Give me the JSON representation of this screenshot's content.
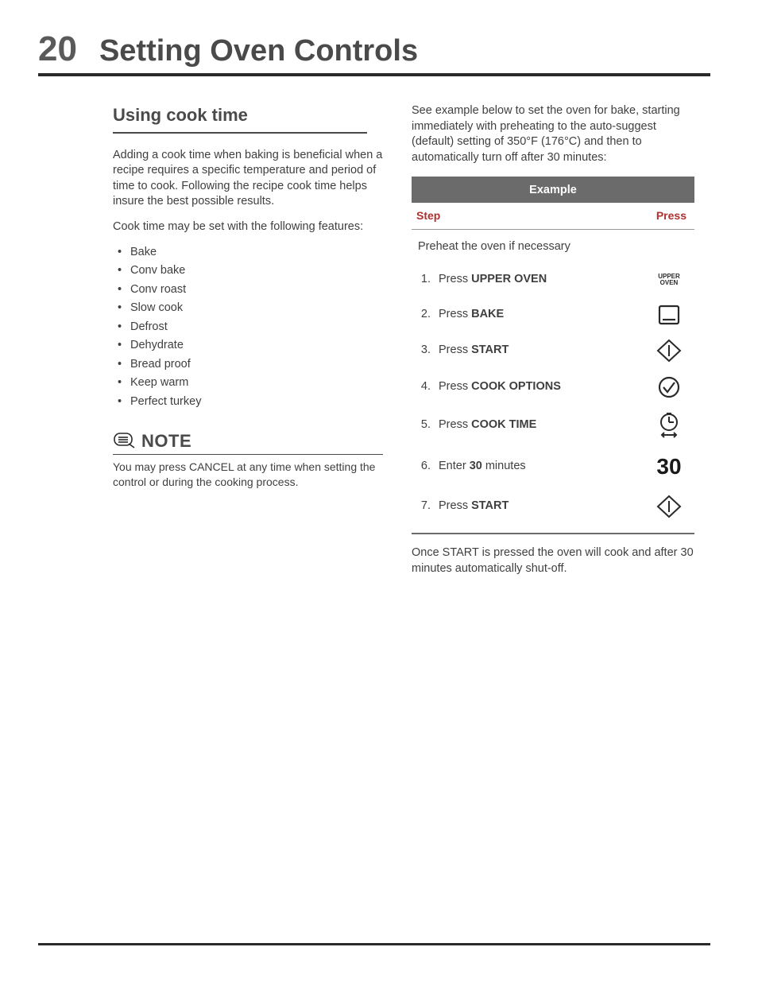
{
  "page_number": "20",
  "page_title": "Setting Oven Controls",
  "section_heading": "Using cook time",
  "intro_para": "Adding a cook time when baking is beneficial when a recipe requires a specific temperature and period of time to cook. Following the recipe cook time helps insure the best possible results.",
  "features_lead": "Cook time may be set with the following features:",
  "features": [
    "Bake",
    "Conv bake",
    "Conv roast",
    "Slow cook",
    "Defrost",
    "Dehydrate",
    "Bread proof",
    "Keep warm",
    "Perfect turkey"
  ],
  "note": {
    "label": "NOTE",
    "text": "You may press CANCEL at any time when setting the control or during the cooking process."
  },
  "right_intro": "See example below to set the oven for bake, starting immediately with preheating to the auto-suggest (default) setting of 350°F (176°C) and then to automatically turn off after 30 minutes:",
  "table": {
    "banner": "Example",
    "col_step": "Step",
    "col_press": "Press",
    "preheat_row": "Preheat the oven if necessary",
    "steps": [
      {
        "n": "1.",
        "pre": "Press ",
        "bold": "UPPER OVEN",
        "post": "",
        "icon": "upper-oven"
      },
      {
        "n": "2.",
        "pre": "Press ",
        "bold": "BAKE",
        "post": "",
        "icon": "bake"
      },
      {
        "n": "3.",
        "pre": "Press ",
        "bold": "START",
        "post": "",
        "icon": "start"
      },
      {
        "n": "4.",
        "pre": "Press ",
        "bold": "COOK OPTIONS",
        "post": "",
        "icon": "options"
      },
      {
        "n": "5.",
        "pre": "Press ",
        "bold": "COOK TIME",
        "post": "",
        "icon": "cooktime"
      },
      {
        "n": "6.",
        "pre": "Enter ",
        "bold": "30",
        "post": " minutes",
        "icon": "thirty"
      },
      {
        "n": "7.",
        "pre": "Press ",
        "bold": "START",
        "post": "",
        "icon": "start"
      }
    ]
  },
  "after_table": "Once START is pressed the oven will cook and after 30 minutes automatically shut-off.",
  "icons": {
    "upper_oven_line1": "UPPER",
    "upper_oven_line2": "OVEN",
    "thirty": "30"
  }
}
